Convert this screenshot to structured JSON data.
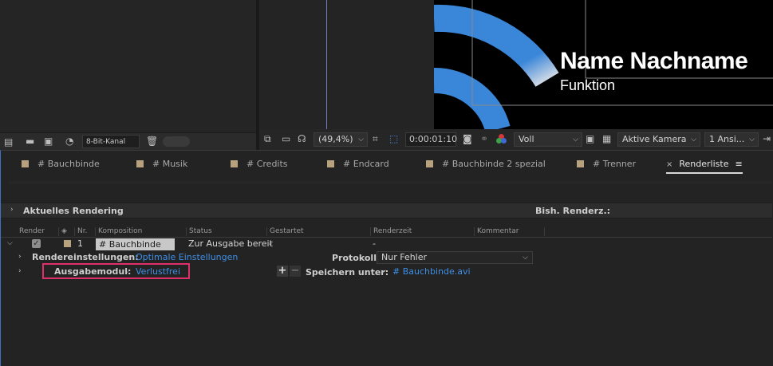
{
  "project_toolbar": {
    "bit_depth": "8-Bit-Kanal"
  },
  "comp_preview": {
    "name": "Name Nachname",
    "role": "Funktion"
  },
  "viewer_toolbar": {
    "zoom": "(49,4%)",
    "timecode": "0:00:01:10",
    "resolution": "Voll",
    "camera": "Aktive Kamera",
    "views": "1 Ansi..."
  },
  "tabs": [
    {
      "label": "# Bauchbinde"
    },
    {
      "label": "# Musik"
    },
    {
      "label": "# Credits"
    },
    {
      "label": "# Endcard"
    },
    {
      "label": "# Bauchbinde 2 spezial"
    },
    {
      "label": "# Trenner"
    },
    {
      "label": "Renderliste",
      "active": true
    }
  ],
  "current_render": {
    "label": "Aktuelles Rendering",
    "elapsed_label": "Bish. Renderz.:"
  },
  "columns": [
    "Render",
    "Nr.",
    "Komposition",
    "Status",
    "Gestartet",
    "Renderzeit",
    "Kommentar"
  ],
  "queue_item": {
    "number": "1",
    "composition": "# Bauchbinde",
    "status": "Zur Ausgabe bereit",
    "started": "-",
    "render_time": "-",
    "render_settings_label": "Rendereinstellungen:",
    "render_settings_value": "Optimale Einstellungen",
    "log_label": "Protokoll:",
    "log_value": "Nur Fehler",
    "output_module_label": "Ausgabemodul:",
    "output_module_value": "Verlustfrei",
    "save_to_label": "Speichern unter:",
    "save_to_value": "# Bauchbinde.avi"
  },
  "colors": {
    "accent_blue": "#3d8fe6",
    "highlight_box": "#e0306a",
    "label_swatch": "#b8a27e"
  }
}
